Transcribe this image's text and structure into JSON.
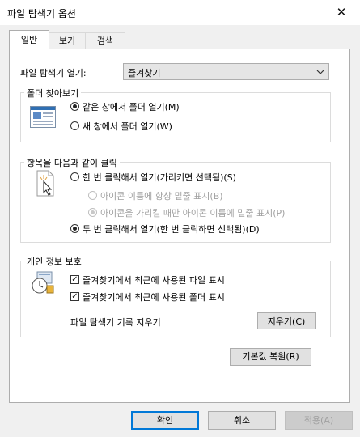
{
  "window": {
    "title": "파일 탐색기 옵션",
    "close_glyph": "✕"
  },
  "tabs": [
    {
      "label": "일반",
      "active": true
    },
    {
      "label": "보기",
      "active": false
    },
    {
      "label": "검색",
      "active": false
    }
  ],
  "open_explorer": {
    "label": "파일 탐색기 열기:",
    "value": "즐겨찾기",
    "arrow_icon": "chevron-down-icon"
  },
  "browse_folders": {
    "group_label": "폴더 찾아보기",
    "options": [
      {
        "label": "같은 창에서 폴더 열기(M)",
        "selected": true
      },
      {
        "label": "새 창에서 폴더 열기(W)",
        "selected": false
      }
    ]
  },
  "click_items": {
    "group_label": "항목을 다음과 같이 클릭",
    "single_click": {
      "label": "한 번 클릭해서 열기(가리키면 선택됨)(S)",
      "selected": false
    },
    "underline_always": {
      "label": "아이콘 이름에 항상 밑줄 표시(B)",
      "selected": false,
      "enabled": false
    },
    "underline_hover": {
      "label": "아이콘을 가리킬 때만 아이콘 이름에 밑줄 표시(P)",
      "selected": true,
      "enabled": false
    },
    "double_click": {
      "label": "두 번 클릭해서 열기(한 번 클릭하면 선택됨)(D)",
      "selected": true
    }
  },
  "privacy": {
    "group_label": "개인 정보 보호",
    "show_recent_files": {
      "label": "즐겨찾기에서 최근에 사용된 파일 표시",
      "checked": true
    },
    "show_frequent_folders": {
      "label": "즐겨찾기에서 최근에 사용된 폴더 표시",
      "checked": true
    },
    "clear_history_label": "파일 탐색기 기록 지우기",
    "clear_button": "지우기(C)"
  },
  "restore_defaults_button": "기본값 복원(R)",
  "footer": {
    "ok": "확인",
    "cancel": "취소",
    "apply": "적용(A)"
  },
  "colors": {
    "accent": "#0078d7",
    "panel": "#ffffff",
    "background": "#f0f0f0"
  }
}
